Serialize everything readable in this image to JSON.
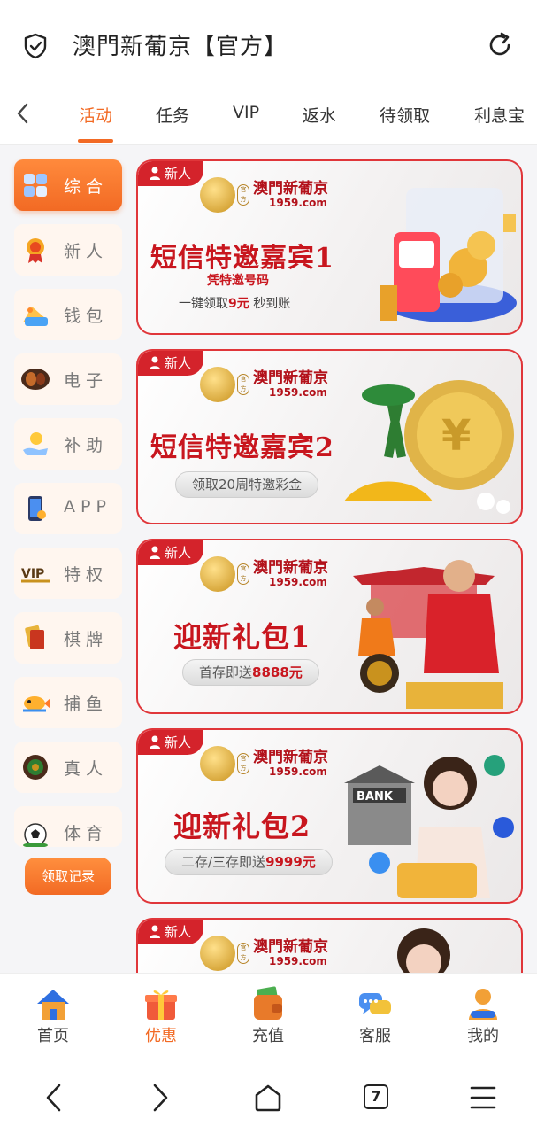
{
  "browser": {
    "title": "澳門新葡京【官方】"
  },
  "tabs": [
    {
      "label": "活动",
      "active": true
    },
    {
      "label": "任务",
      "active": false
    },
    {
      "label": "VIP",
      "active": false
    },
    {
      "label": "返水",
      "active": false
    },
    {
      "label": "待领取",
      "active": false
    },
    {
      "label": "利息宝",
      "active": false
    }
  ],
  "categories": [
    {
      "label": "综合",
      "icon": "grid-icon",
      "active": true
    },
    {
      "label": "新人",
      "icon": "medal-icon",
      "active": false
    },
    {
      "label": "钱包",
      "icon": "wallet-icon",
      "active": false
    },
    {
      "label": "电子",
      "icon": "slot-icon",
      "active": false
    },
    {
      "label": "补助",
      "icon": "coin-hand-icon",
      "active": false
    },
    {
      "label": "APP",
      "icon": "phone-icon",
      "active": false
    },
    {
      "label": "特权",
      "icon": "vip-icon",
      "active": false
    },
    {
      "label": "棋牌",
      "icon": "cards-icon",
      "active": false
    },
    {
      "label": "捕鱼",
      "icon": "fish-icon",
      "active": false
    },
    {
      "label": "真人",
      "icon": "roulette-icon",
      "active": false
    },
    {
      "label": "体育",
      "icon": "soccer-icon",
      "active": false
    }
  ],
  "record_button": "领取记录",
  "banners": [
    {
      "tag": "新人",
      "brand": "澳門新葡京",
      "domain": "1959.com",
      "badge": "官方",
      "headline": "短信特邀嘉宾1",
      "sub1": "凭特邀号码",
      "sub2_prefix": "一键领取",
      "sub2_highlight": "9元",
      "sub2_suffix": " 秒到账"
    },
    {
      "tag": "新人",
      "brand": "澳門新葡京",
      "domain": "1959.com",
      "badge": "官方",
      "headline": "短信特邀嘉宾2",
      "pill_text": "领取20周特邀彩金"
    },
    {
      "tag": "新人",
      "brand": "澳門新葡京",
      "domain": "1959.com",
      "badge": "官方",
      "headline": "迎新礼包1",
      "pill_prefix": "首存即送",
      "pill_highlight": "8888元"
    },
    {
      "tag": "新人",
      "brand": "澳門新葡京",
      "domain": "1959.com",
      "badge": "官方",
      "headline": "迎新礼包2",
      "pill_prefix": "二存/三存即送",
      "pill_highlight": "9999元",
      "art_text": "BANK"
    },
    {
      "tag": "新人",
      "brand": "澳門新葡京",
      "domain": "1959.com",
      "badge": "官方"
    }
  ],
  "bottom_nav": [
    {
      "label": "首页",
      "icon": "home-icon",
      "active": false
    },
    {
      "label": "优惠",
      "icon": "gift-icon",
      "active": true
    },
    {
      "label": "充值",
      "icon": "wallet-icon",
      "active": false
    },
    {
      "label": "客服",
      "icon": "chat-icon",
      "active": false
    },
    {
      "label": "我的",
      "icon": "user-icon",
      "active": false
    }
  ],
  "browser_nav": {
    "tab_count": "7"
  },
  "colors": {
    "accent": "#f26a24",
    "banner_red": "#c8161e",
    "tag_red": "#d4232b"
  }
}
